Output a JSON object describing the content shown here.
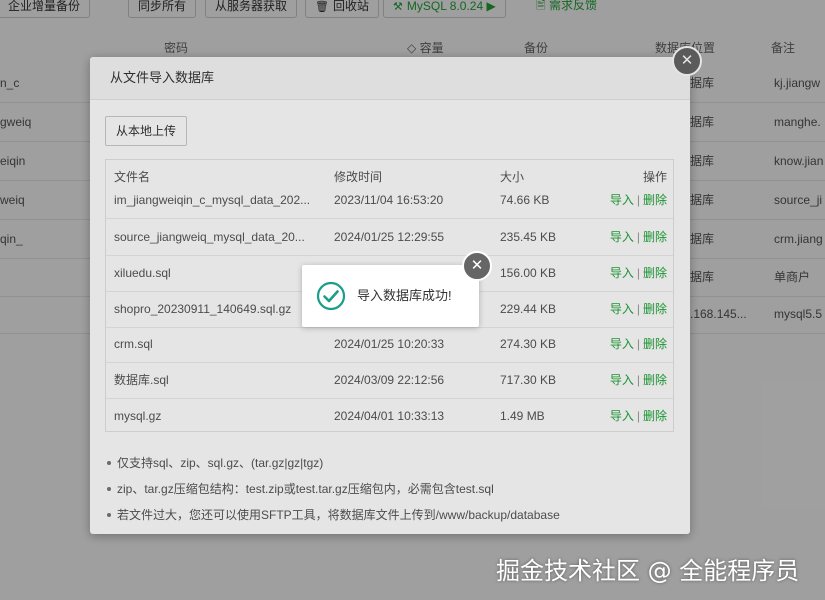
{
  "background": {
    "toolbar": {
      "enterprise_backup": "企业增量备份",
      "sync_all": "同步所有",
      "fetch_from_server": "从服务器获取",
      "recycle_bin": "回收站",
      "mysql_version": "MySQL 8.0.24",
      "feedback": "需求反馈"
    },
    "headers": {
      "password": "密码",
      "capacity": "容量",
      "backup": "备份",
      "db_location": "数据库位置",
      "remark": "备注"
    },
    "rows": [
      {
        "name": "n_c",
        "location": "据库",
        "remark": "kj.jiangw"
      },
      {
        "name": "gweiq",
        "location": "据库",
        "remark": "manghe."
      },
      {
        "name": "eiqin",
        "location": "据库",
        "remark": "know.jian"
      },
      {
        "name": "weiq",
        "location": "据库",
        "remark": "source_ji"
      },
      {
        "name": "qin_",
        "location": "据库",
        "remark": "crm.jiang"
      },
      {
        "name": "",
        "location": "据库",
        "remark": "单商户"
      },
      {
        "name": "",
        "location": ".168.145...",
        "remark": "mysql5.5"
      }
    ]
  },
  "dialog": {
    "title": "从文件导入数据库",
    "upload_button": "从本地上传",
    "columns": {
      "name": "文件名",
      "modified": "修改时间",
      "size": "大小",
      "ops": "操作"
    },
    "op_import": "导入",
    "op_separator": "|",
    "op_delete": "删除",
    "files": [
      {
        "name": "im_jiangweiqin_c_mysql_data_202...",
        "modified": "2023/11/04 16:53:20",
        "size": "74.66 KB"
      },
      {
        "name": "source_jiangweiq_mysql_data_20...",
        "modified": "2024/01/25 12:29:55",
        "size": "235.45 KB"
      },
      {
        "name": "xiluedu.sql",
        "modified": "",
        "size": "156.00 KB"
      },
      {
        "name": "shopro_20230911_140649.sql.gz",
        "modified": "",
        "size": "229.44 KB"
      },
      {
        "name": "crm.sql",
        "modified": "2024/01/25 10:20:33",
        "size": "274.30 KB"
      },
      {
        "name": "数据库.sql",
        "modified": "2024/03/09 22:12:56",
        "size": "717.30 KB"
      },
      {
        "name": "mysql.gz",
        "modified": "2024/04/01 10:33:13",
        "size": "1.49 MB"
      }
    ],
    "notes": [
      "仅支持sql、zip、sql.gz、(tar.gz|gz|tgz)",
      "zip、tar.gz压缩包结构：test.zip或test.tar.gz压缩包内，必需包含test.sql",
      "若文件过大，您还可以使用SFTP工具，将数据库文件上传到/www/backup/database"
    ]
  },
  "toast": {
    "message": "导入数据库成功!"
  },
  "watermark": "掘金技术社区 @ 全能程序员",
  "colors": {
    "accent_green": "#20a53a",
    "toast_check": "#1a9e8a",
    "close_button": "#666666"
  }
}
